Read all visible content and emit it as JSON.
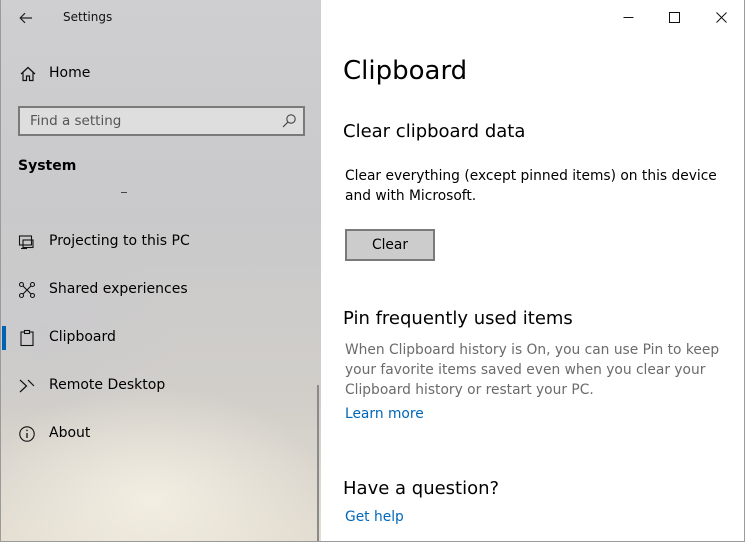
{
  "window": {
    "app_title": "Settings",
    "back_icon": "arrow-left-icon",
    "controls": {
      "minimize_icon": "minimize-icon",
      "maximize_icon": "maximize-icon",
      "close_icon": "close-icon"
    }
  },
  "sidebar": {
    "home_label": "Home",
    "search_placeholder": "Find a setting",
    "section_label": "System",
    "items": [
      {
        "label": "Projecting to this PC",
        "icon": "projector-icon",
        "selected": false
      },
      {
        "label": "Shared experiences",
        "icon": "shared-experiences-icon",
        "selected": false
      },
      {
        "label": "Clipboard",
        "icon": "clipboard-icon",
        "selected": true
      },
      {
        "label": "Remote Desktop",
        "icon": "remote-desktop-icon",
        "selected": false
      },
      {
        "label": "About",
        "icon": "info-icon",
        "selected": false
      }
    ],
    "accent_color": "#0063b1"
  },
  "main": {
    "page_title": "Clipboard",
    "clear_section": {
      "heading": "Clear clipboard data",
      "description_line1": "Clear everything (except pinned items) on this device",
      "description_line2": "and with Microsoft.",
      "button_label": "Clear"
    },
    "pin_section": {
      "heading": "Pin frequently used items",
      "description_line1": "When Clipboard history is On, you can use Pin to keep",
      "description_line2": "your favorite items saved even when you clear your",
      "description_line3": "Clipboard history or restart your PC.",
      "link_label": "Learn more"
    },
    "question_section": {
      "heading": "Have a question?",
      "link_label": "Get help"
    },
    "link_color": "#0067b8"
  }
}
